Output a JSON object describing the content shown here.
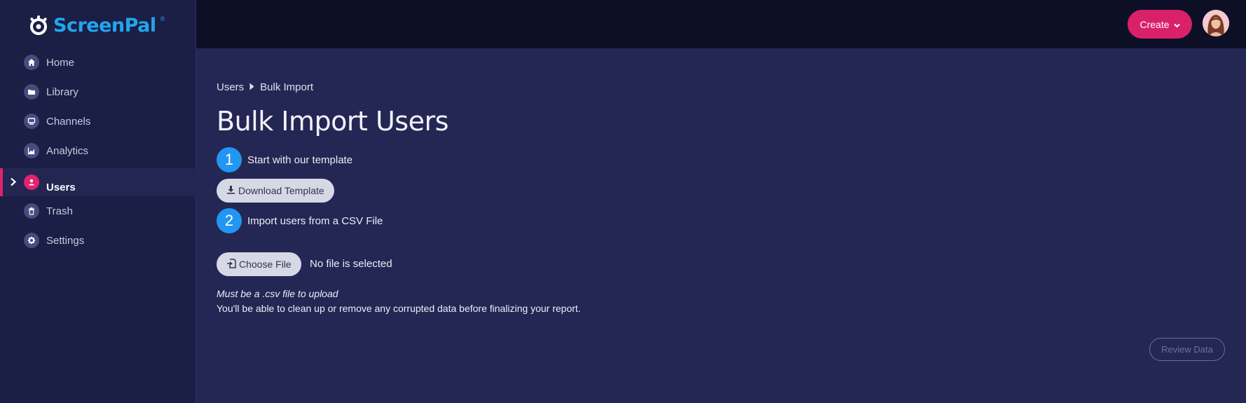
{
  "app": {
    "logo_text": "ScreenPal",
    "logo_reg": "®"
  },
  "sidebar": {
    "items": [
      {
        "label": "Home",
        "icon": "home-icon"
      },
      {
        "label": "Library",
        "icon": "folder-icon"
      },
      {
        "label": "Channels",
        "icon": "channels-icon"
      },
      {
        "label": "Analytics",
        "icon": "analytics-icon"
      },
      {
        "label": "Users",
        "icon": "user-icon",
        "active": true
      },
      {
        "label": "Trash",
        "icon": "trash-icon"
      },
      {
        "label": "Settings",
        "icon": "gear-icon"
      }
    ]
  },
  "header": {
    "create_label": "Create"
  },
  "breadcrumb": {
    "parent": "Users",
    "current": "Bulk Import"
  },
  "main": {
    "title": "Bulk Import Users",
    "step1": {
      "num": "1",
      "label": "Start with our template"
    },
    "download_label": "Download Template",
    "step2": {
      "num": "2",
      "label": "Import users from a CSV File"
    },
    "choose_file_label": "Choose File",
    "file_status": "No file is selected",
    "note_italic": "Must be a .csv file to upload",
    "note": "You'll be able to clean up or remove any corrupted data before finalizing your report.",
    "review_label": "Review Data"
  },
  "colors": {
    "accent": "#d92169",
    "step": "#2196f3",
    "sidebar_bg": "#1b1e45",
    "main_bg": "#242754",
    "topbar_bg": "#0d0f27"
  }
}
